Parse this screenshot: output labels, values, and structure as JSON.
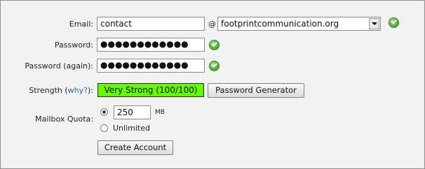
{
  "form": {
    "email_label": "Email:",
    "email_value": "contact",
    "at_sign": "@",
    "domain_value": "footprintcommunication.org",
    "password_label": "Password:",
    "password_value": "●●●●●●●●●●●●",
    "password_again_label": "Password (again):",
    "password_again_value": "●●●●●●●●●●●●",
    "strength_label_prefix": "Strength (",
    "strength_why_link": "why?",
    "strength_label_suffix": "):",
    "strength_value": "Very Strong (100/100)",
    "generator_button": "Password Generator",
    "quota_label": "Mailbox Quota:",
    "quota_value": "250",
    "quota_unit": "MB",
    "unlimited_label": "Unlimited",
    "create_button": "Create Account"
  },
  "colors": {
    "strength_bg": "#66ff00",
    "check_green": "#4a9c32",
    "link": "#2c6aa0"
  },
  "icons": {
    "valid": "check-circle-icon"
  }
}
